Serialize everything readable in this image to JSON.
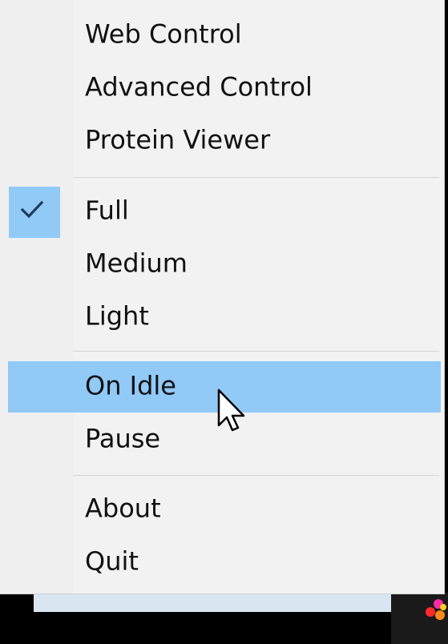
{
  "menu": {
    "items": [
      {
        "label": "Web Control"
      },
      {
        "label": "Advanced Control"
      },
      {
        "label": "Protein Viewer"
      },
      {
        "label": "Full",
        "checked": true
      },
      {
        "label": "Medium"
      },
      {
        "label": "Light"
      },
      {
        "label": "On Idle",
        "highlighted": true
      },
      {
        "label": "Pause"
      },
      {
        "label": "About"
      },
      {
        "label": "Quit"
      }
    ]
  },
  "icons": {
    "check": "checkmark-icon",
    "cursor": "mouse-pointer-icon",
    "tray": "folding-at-home-tray-icon"
  },
  "colors": {
    "menu_bg": "#f2f2f2",
    "highlight": "#91c9f7",
    "separator": "#d4d4d4",
    "text": "#111111"
  }
}
